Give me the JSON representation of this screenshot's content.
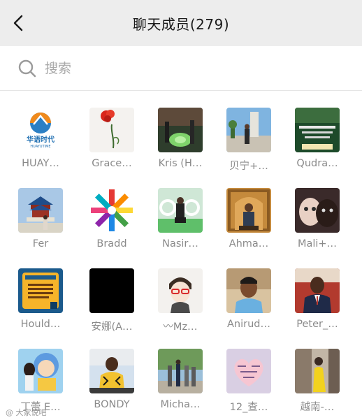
{
  "header": {
    "title": "聊天成员(279)"
  },
  "search": {
    "placeholder": "搜索"
  },
  "members": [
    {
      "name": "HUAY…",
      "logo_line1": "华语时代",
      "logo_line2": "HUAYUTIME"
    },
    {
      "name": "Grace…"
    },
    {
      "name": "Kris (H…"
    },
    {
      "name": "贝宁+…"
    },
    {
      "name": "Qudra…"
    },
    {
      "name": "Fer"
    },
    {
      "name": "Bradd"
    },
    {
      "name": "Nasir…"
    },
    {
      "name": "Ahma…"
    },
    {
      "name": "Mali+…"
    },
    {
      "name": "Hould…"
    },
    {
      "name": "安娜(A…"
    },
    {
      "name": "〰Mz…"
    },
    {
      "name": "Anirud…"
    },
    {
      "name": "Peter_…"
    },
    {
      "name": "丁蕾 E…"
    },
    {
      "name": "BONDY"
    },
    {
      "name": "Micha…"
    },
    {
      "name": "12_查…"
    },
    {
      "name": "越南-…"
    }
  ],
  "watermark": "@ 大家说吧",
  "colors": {
    "header_bg": "#ededed",
    "name_text": "#8a8a8a",
    "divider": "#e5e5e5"
  }
}
